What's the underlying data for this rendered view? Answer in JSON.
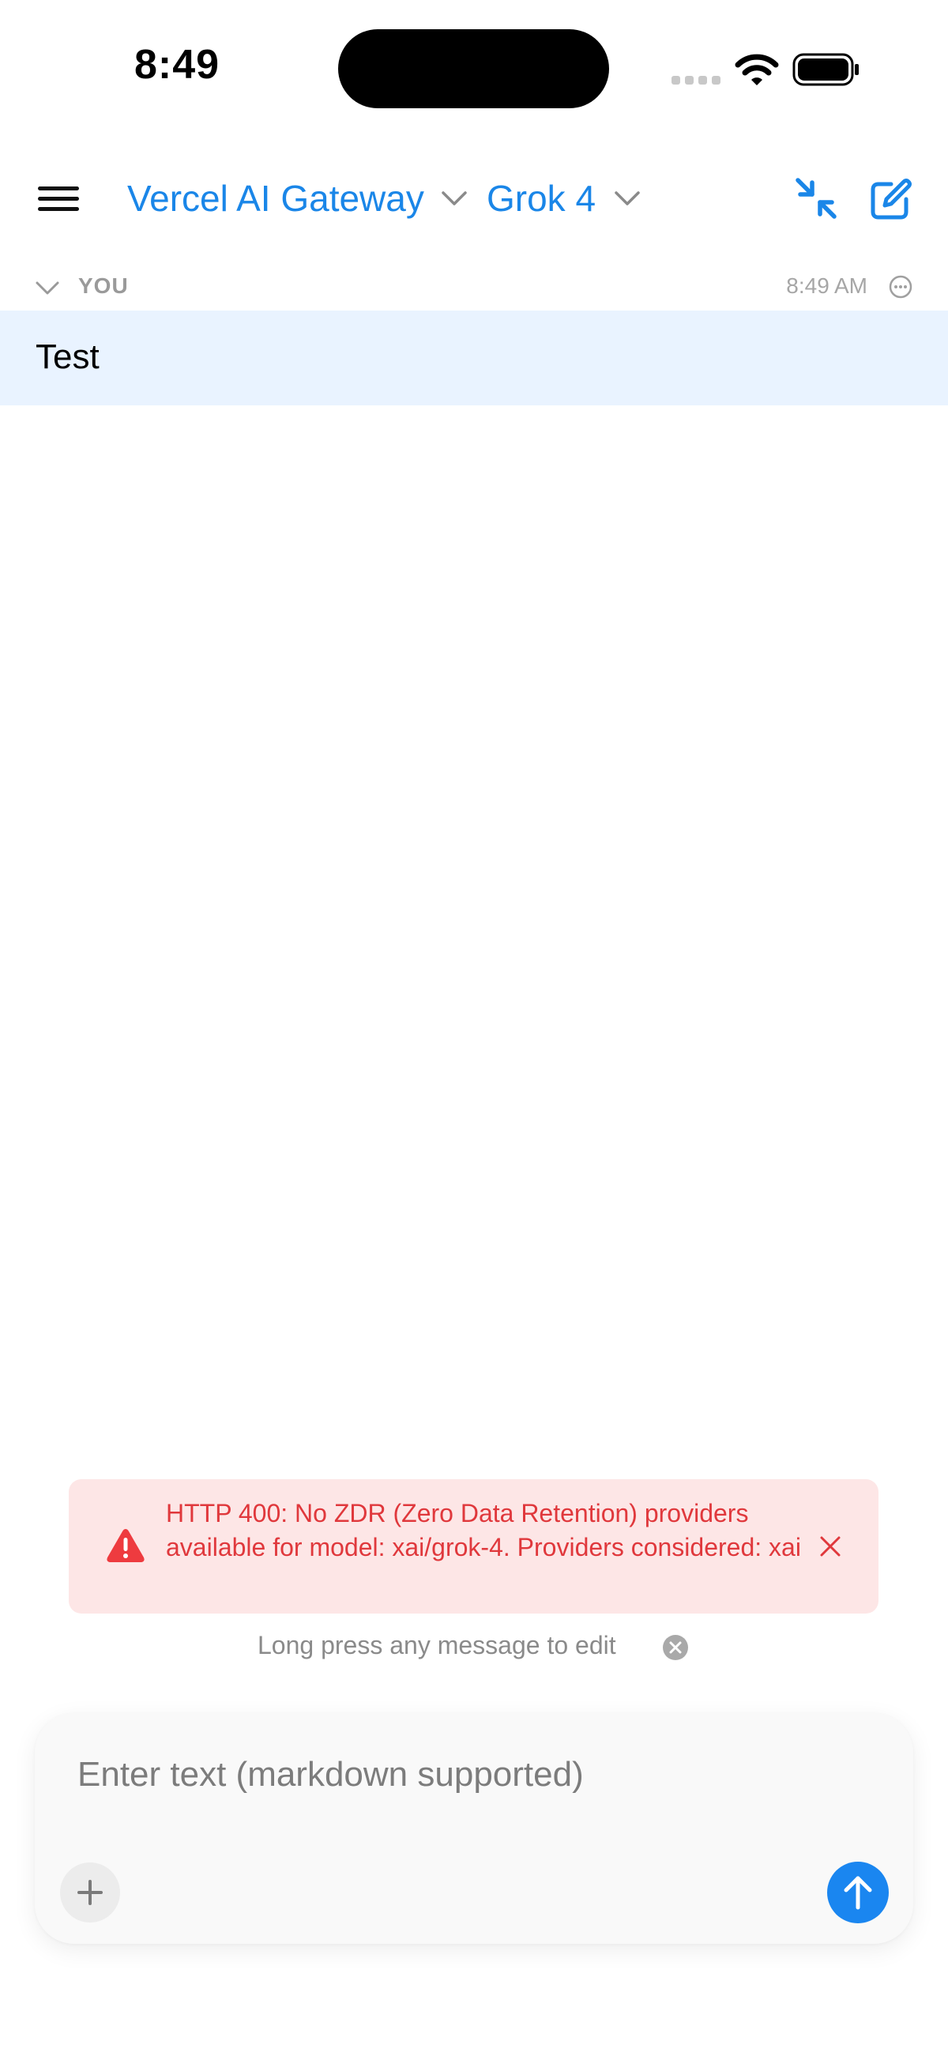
{
  "status_bar": {
    "time": "8:49"
  },
  "header": {
    "provider": "Vercel AI Gateway",
    "model": "Grok 4",
    "accent_color": "#1a86e8"
  },
  "messages": [
    {
      "author": "YOU",
      "time": "8:49 AM",
      "text": "Test"
    }
  ],
  "error": {
    "message": "HTTP 400: No ZDR (Zero Data Retention) providers available for model: xai/grok-4. Providers considered: xai",
    "color": "#e0383c",
    "background": "#fde6e6"
  },
  "hint": {
    "text": "Long press any message to edit"
  },
  "composer": {
    "value": "",
    "placeholder": "Enter text (markdown supported)",
    "send_color": "#1a86f0"
  },
  "icons": {
    "menu": "hamburger-menu-icon",
    "provider_dropdown": "chevron-down-icon",
    "model_dropdown": "chevron-down-icon",
    "collapse": "arrows-collapse-icon",
    "compose": "compose-icon",
    "message_more": "ellipsis-circle-icon",
    "error": "warning-triangle-icon",
    "error_dismiss": "close-icon",
    "hint_dismiss": "close-circle-icon",
    "attach": "plus-icon",
    "send": "arrow-up-icon"
  }
}
